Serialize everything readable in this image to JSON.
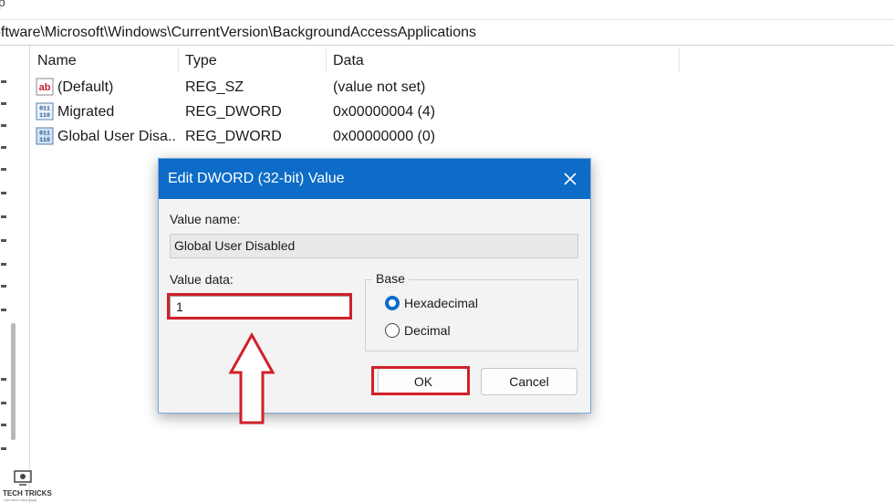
{
  "menubar": {
    "fragment": "p"
  },
  "address": {
    "path": "oftware\\Microsoft\\Windows\\CurrentVersion\\BackgroundAccessApplications"
  },
  "columns": {
    "name": "Name",
    "type": "Type",
    "data": "Data"
  },
  "rows": [
    {
      "name": "(Default)",
      "type": "REG_SZ",
      "data": "(value not set)",
      "icon": "string-value-icon"
    },
    {
      "name": "Migrated",
      "type": "REG_DWORD",
      "data": "0x00000004 (4)",
      "icon": "binary-value-icon"
    },
    {
      "name": "Global User Disa...",
      "type": "REG_DWORD",
      "data": "0x00000000 (0)",
      "icon": "binary-value-icon"
    }
  ],
  "dialog": {
    "title": "Edit DWORD (32-bit) Value",
    "value_name_label": "Value name:",
    "value_name": "Global User Disabled",
    "value_data_label": "Value data:",
    "value_data": "1",
    "base_label": "Base",
    "hex_label": "Hexadecimal",
    "decimal_label": "Decimal",
    "base_selected": "Hexadecimal",
    "ok_label": "OK",
    "cancel_label": "Cancel"
  },
  "logo": {
    "text": "TECH TRICKS",
    "subtext": "THỦ THUẬT CÔNG NGHỆ"
  },
  "colors": {
    "title_bar": "#0d6cc7",
    "highlight": "#d0202a",
    "radio_selected": "#0d6cc7"
  }
}
